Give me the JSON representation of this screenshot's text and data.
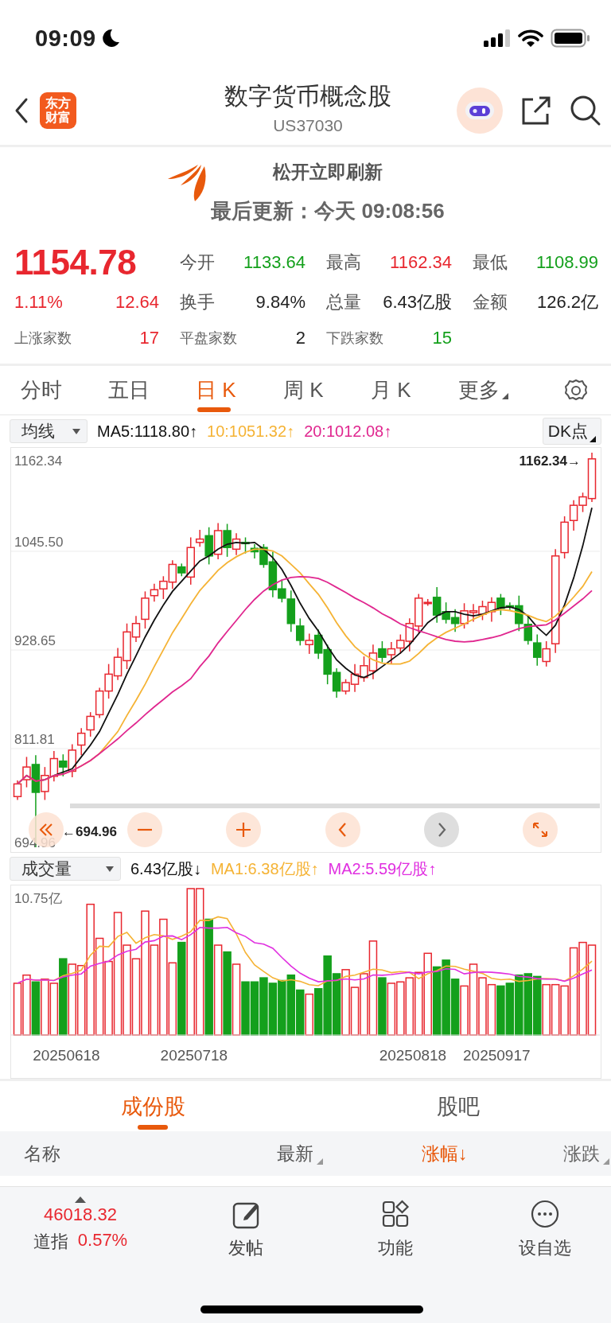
{
  "status_bar": {
    "time": "09:09"
  },
  "header": {
    "logo_lines": [
      "东方",
      "财富"
    ],
    "title": "数字货币概念股",
    "code": "US37030"
  },
  "refresh": {
    "hint": "松开立即刷新",
    "updated": "最后更新：今天 09:08:56"
  },
  "quote": {
    "price": "1154.78",
    "change_pct": "1.11%",
    "change": "12.64",
    "color": "#e8272f",
    "stats": [
      {
        "label": "今开",
        "value": "1133.64",
        "color": "#14a01c"
      },
      {
        "label": "最高",
        "value": "1162.34",
        "color": "#e8272f"
      },
      {
        "label": "最低",
        "value": "1108.99",
        "color": "#14a01c"
      },
      {
        "label": "换手",
        "value": "9.84%",
        "color": "#222222"
      },
      {
        "label": "总量",
        "value": "6.43亿股",
        "color": "#222222"
      },
      {
        "label": "金额",
        "value": "126.2亿",
        "color": "#222222"
      }
    ],
    "breadth": [
      {
        "label": "上涨家数",
        "value": "17",
        "color": "#e8272f"
      },
      {
        "label": "平盘家数",
        "value": "2",
        "color": "#222222"
      },
      {
        "label": "下跌家数",
        "value": "15",
        "color": "#14a01c"
      }
    ]
  },
  "period_tabs": [
    {
      "label": "分时",
      "selected": false
    },
    {
      "label": "五日",
      "selected": false
    },
    {
      "label": "日 K",
      "selected": true
    },
    {
      "label": "周 K",
      "selected": false
    },
    {
      "label": "月 K",
      "selected": false
    },
    {
      "label": "更多",
      "selected": false,
      "dropdown": true
    }
  ],
  "ma_bar": {
    "selector": "均线",
    "items": [
      {
        "text": "MA5:1118.80↑",
        "color": "#111111"
      },
      {
        "text": "10:1051.32↑",
        "color": "#f5b335"
      },
      {
        "text": "20:1012.08↑",
        "color": "#e0278f"
      }
    ],
    "dk_button": "DK点"
  },
  "price_chart": {
    "axis_labels": [
      "1162.34",
      "1045.50",
      "928.65",
      "811.81",
      "694.96"
    ],
    "high_marker": "1162.34→",
    "low_marker": "←694.96",
    "controls": [
      {
        "kind": "fast-back",
        "disabled": false
      },
      {
        "kind": "zoom-out",
        "disabled": false
      },
      {
        "kind": "zoom-in",
        "disabled": false
      },
      {
        "kind": "back",
        "disabled": false
      },
      {
        "kind": "forward",
        "disabled": true
      },
      {
        "kind": "expand",
        "disabled": false
      }
    ]
  },
  "volume": {
    "selector": "成交量",
    "items": [
      {
        "text": "6.43亿股↓",
        "color": "#111111"
      },
      {
        "text": "MA1:6.38亿股↑",
        "color": "#f5b335"
      },
      {
        "text": "MA2:5.59亿股↑",
        "color": "#e030e0"
      }
    ],
    "axis_max": "10.75亿",
    "dates": [
      "20250618",
      "20250718",
      "20250818",
      "20250917"
    ]
  },
  "bottom_tabs": [
    {
      "label": "成份股",
      "selected": true
    },
    {
      "label": "股吧",
      "selected": false
    }
  ],
  "table_header": [
    {
      "label": "名称",
      "selected": false,
      "sortable": false
    },
    {
      "label": "最新",
      "selected": false,
      "sortable": true
    },
    {
      "label": "涨幅↓",
      "selected": true,
      "sortable": false
    },
    {
      "label": "涨跌",
      "selected": false,
      "sortable": true
    }
  ],
  "index_ticker": {
    "value": "46018.32",
    "name": "道指",
    "change": "0.57%"
  },
  "toolbar": [
    {
      "kind": "post",
      "label": "发帖"
    },
    {
      "kind": "functions",
      "label": "功能"
    },
    {
      "kind": "watchlist",
      "label": "设自选"
    }
  ]
}
